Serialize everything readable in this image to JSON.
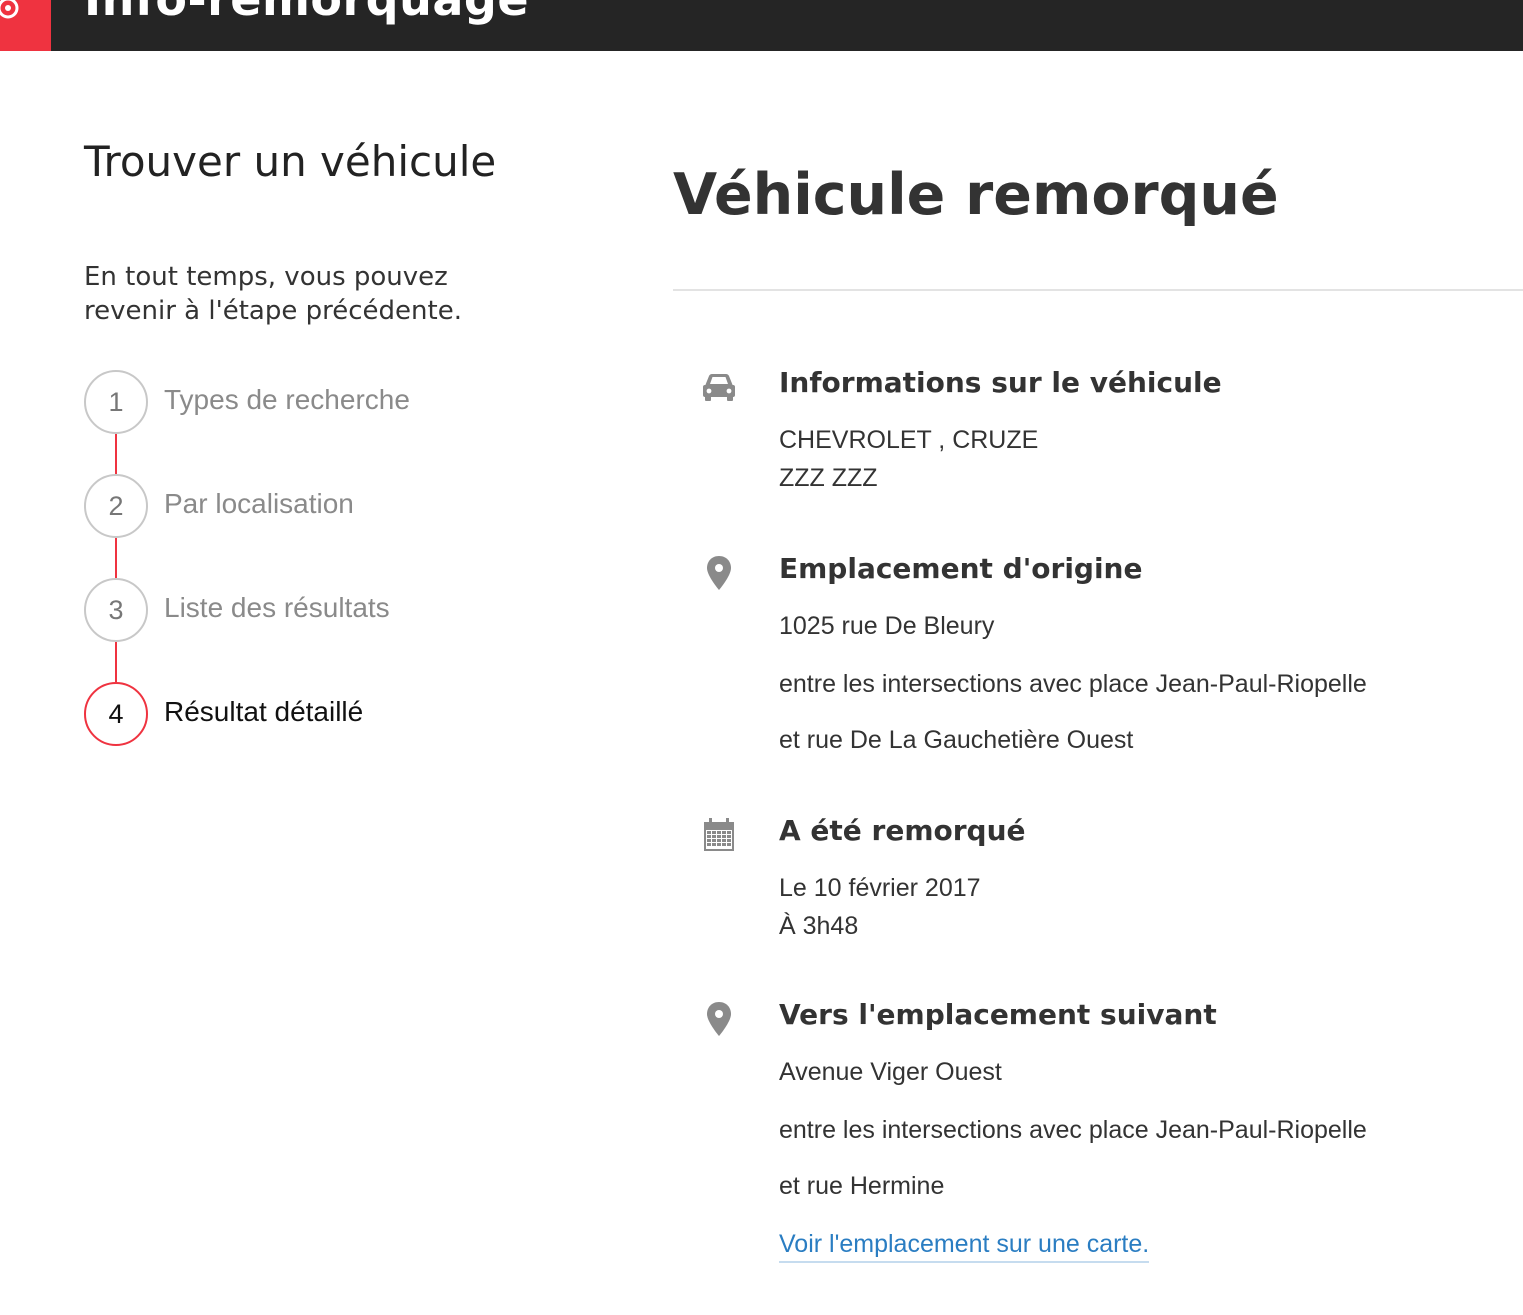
{
  "header": {
    "app_title": "Info-remorquage",
    "brand_color": "#ef3340",
    "bar_color": "#252525",
    "logo_icon": "city-rosette-icon"
  },
  "sidebar": {
    "title": "Trouver un véhicule",
    "subtitle": "En tout temps, vous pouvez revenir à l'étape précédente.",
    "steps": [
      {
        "number": "1",
        "label": "Types de recherche"
      },
      {
        "number": "2",
        "label": "Par localisation"
      },
      {
        "number": "3",
        "label": "Liste des résultats"
      },
      {
        "number": "4",
        "label": "Résultat détaillé",
        "active": true
      }
    ]
  },
  "main": {
    "title": "Véhicule remorqué",
    "vehicle": {
      "icon": "car-icon",
      "title": "Informations sur le véhicule",
      "make_model": "CHEVROLET , CRUZE",
      "plate": "ZZZ ZZZ"
    },
    "origin": {
      "icon": "map-pin-icon",
      "title": "Emplacement d'origine",
      "street": "1025 rue De Bleury",
      "between": "entre les intersections avec place Jean-Paul-Riopelle",
      "and": "et rue De La Gauchetière Ouest"
    },
    "towed": {
      "icon": "calendar-icon",
      "title": "A été remorqué",
      "date": "Le 10 février 2017",
      "time": "À 3h48"
    },
    "destination": {
      "icon": "map-pin-icon",
      "title": "Vers l'emplacement suivant",
      "street": "Avenue Viger Ouest",
      "between": "entre les intersections avec place Jean-Paul-Riopelle",
      "and": "et rue Hermine",
      "map_link": "Voir l'emplacement sur une carte."
    }
  }
}
